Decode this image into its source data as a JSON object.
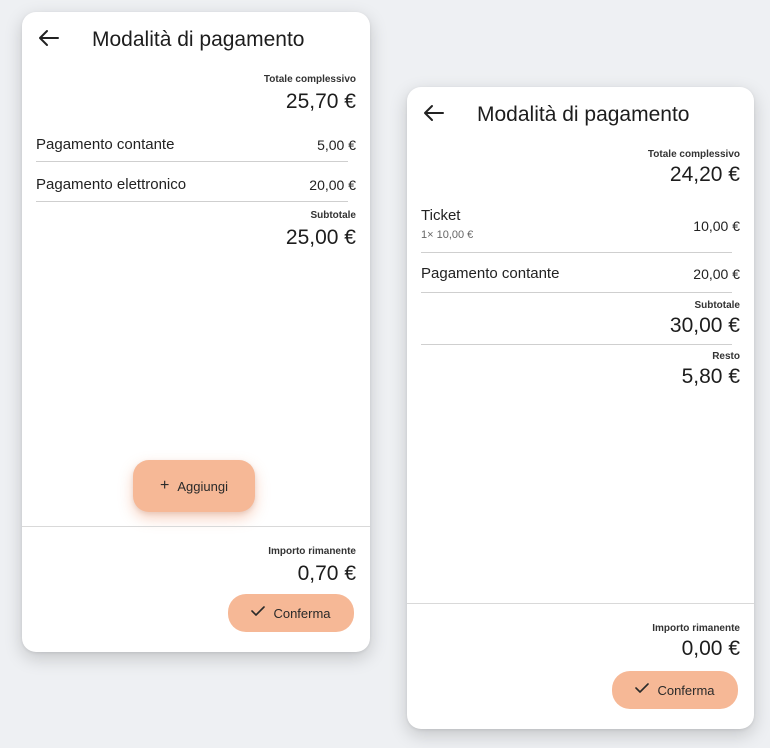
{
  "left_screen": {
    "header": {
      "back_icon": "arrow-left-icon",
      "title": "Modalità di pagamento"
    },
    "total": {
      "label": "Totale complessivo",
      "value": "25,70 €"
    },
    "payments": [
      {
        "label": "Pagamento contante",
        "amount": "5,00 €"
      },
      {
        "label": "Pagamento elettronico",
        "amount": "20,00 €"
      }
    ],
    "subtotal": {
      "label": "Subtotale",
      "value": "25,00 €"
    },
    "add_button": {
      "icon": "plus-icon",
      "label": "Aggiungi"
    },
    "remaining": {
      "label": "Importo rimanente",
      "value": "0,70 €"
    },
    "confirm_button": {
      "icon": "check-icon",
      "label": "Conferma"
    }
  },
  "right_screen": {
    "header": {
      "back_icon": "arrow-left-icon",
      "title": "Modalità di pagamento"
    },
    "total": {
      "label": "Totale complessivo",
      "value": "24,20 €"
    },
    "payments": [
      {
        "label": "Ticket",
        "detail": "1× 10,00 €",
        "amount": "10,00 €"
      },
      {
        "label": "Pagamento contante",
        "amount": "20,00 €"
      }
    ],
    "subtotal": {
      "label": "Subtotale",
      "value": "30,00 €"
    },
    "change": {
      "label": "Resto",
      "value": "5,80 €"
    },
    "remaining": {
      "label": "Importo rimanente",
      "value": "0,00 €"
    },
    "confirm_button": {
      "icon": "check-icon",
      "label": "Conferma"
    }
  },
  "colors": {
    "accent": "#f6b896",
    "background": "#eef0f3",
    "card": "#ffffff"
  }
}
